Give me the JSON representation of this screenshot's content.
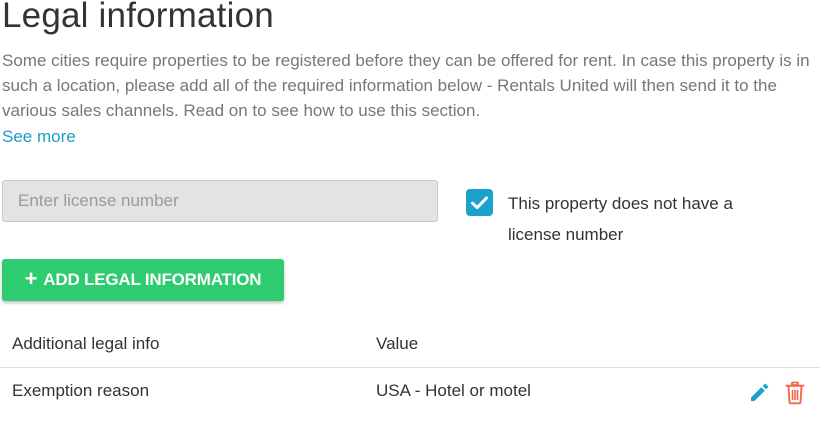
{
  "title": "Legal information",
  "intro": "Some cities require properties to be registered before they can be offered for rent. In case this property is in such a location, please add all of the required information below - Rentals United will then send it to the various sales channels. Read on to see how to use this section.",
  "see_more": "See more",
  "license_input": {
    "placeholder": "Enter license number",
    "value": ""
  },
  "no_license_checkbox": {
    "checked": true,
    "label": "This property does not have a license number"
  },
  "add_button": {
    "icon": "plus-icon",
    "label": "ADD LEGAL INFORMATION"
  },
  "table": {
    "columns": [
      "Additional legal info",
      "Value"
    ],
    "rows": [
      {
        "info": "Exemption reason",
        "value": "USA - Hotel or motel",
        "actions": [
          "pencil-icon",
          "trash-icon"
        ]
      }
    ]
  },
  "colors": {
    "accent": "#1ba1cd",
    "link": "#1f9bc7",
    "button_green": "#2ecb70",
    "delete_red": "#f2674a",
    "muted_text": "#777777"
  }
}
